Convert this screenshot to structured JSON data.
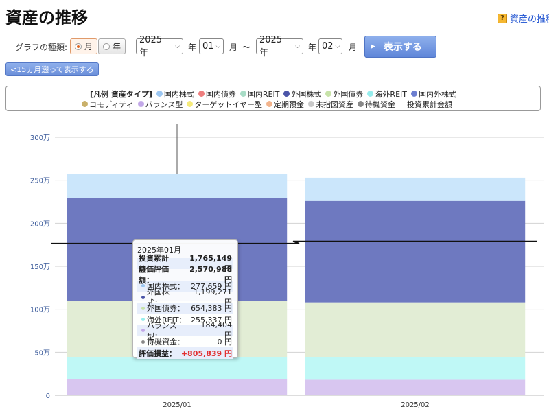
{
  "page": {
    "title": "資産の推移",
    "help_link": "資産の推移",
    "help_icon": "?"
  },
  "controls": {
    "graph_type_label": "グラフの種類:",
    "radio_month": "月",
    "radio_year": "年",
    "selected": "month",
    "from_year": "2025 年",
    "from_year_unit": "年",
    "from_month": "01",
    "from_month_unit": "月",
    "range_sep": "〜",
    "to_year": "2025 年",
    "to_year_unit": "年",
    "to_month": "02",
    "to_month_unit": "月",
    "show_button": "表示する",
    "back_button": "<15ヵ月遡って表示する"
  },
  "legend": {
    "heading": "[凡例 資産タイプ]",
    "items": [
      {
        "label": "国内株式",
        "color": "#9cc7f2"
      },
      {
        "label": "国内債券",
        "color": "#ee7e7e"
      },
      {
        "label": "国内REIT",
        "color": "#a8dcc6"
      },
      {
        "label": "外国株式",
        "color": "#4b55a8"
      },
      {
        "label": "外国債券",
        "color": "#c7e2a8"
      },
      {
        "label": "海外REIT",
        "color": "#96eded"
      },
      {
        "label": "国内外株式",
        "color": "#6d7fd0"
      },
      {
        "label": "コモディティ",
        "color": "#c9b06a"
      },
      {
        "label": "バランス型",
        "color": "#c2a8e8"
      },
      {
        "label": "ターゲットイヤー型",
        "color": "#f5ea7a"
      },
      {
        "label": "定期預金",
        "color": "#f3b48c"
      },
      {
        "label": "未指図資産",
        "color": "#c9c9c9"
      },
      {
        "label": "待機資金",
        "color": "#888888"
      }
    ],
    "line_label": "投資累計金額"
  },
  "chart_data": {
    "type": "bar",
    "stacked": true,
    "categories": [
      "2025/01",
      "2025/02"
    ],
    "ylim": [
      0,
      3000000
    ],
    "y_ticks": [
      {
        "value": 0,
        "label": "0"
      },
      {
        "value": 500000,
        "label": "50万"
      },
      {
        "value": 1000000,
        "label": "100万"
      },
      {
        "value": 1500000,
        "label": "150万"
      },
      {
        "value": 2000000,
        "label": "200万"
      },
      {
        "value": 2500000,
        "label": "250万"
      },
      {
        "value": 3000000,
        "label": "300万"
      }
    ],
    "series": [
      {
        "name": "バランス型",
        "color": "#d8c6f0",
        "values": [
          184404,
          180000
        ]
      },
      {
        "name": "海外REIT",
        "color": "#bff8f6",
        "values": [
          255337,
          260000
        ]
      },
      {
        "name": "外国債券",
        "color": "#e2edd5",
        "values": [
          654383,
          640000
        ]
      },
      {
        "name": "外国株式",
        "color": "#6e79c0",
        "values": [
          1199271,
          1180000
        ]
      },
      {
        "name": "国内株式",
        "color": "#cbe6fb",
        "values": [
          277659,
          270000
        ]
      }
    ],
    "line": {
      "name": "投資累計金額",
      "color": "#111111",
      "values": [
        1765149,
        1790000
      ]
    },
    "grid": true
  },
  "tooltip": {
    "date": "2025年01月",
    "rows": [
      {
        "label": "投資累計額：",
        "value": "1,765,149 円",
        "bold": true,
        "shaded": true,
        "dot": ""
      },
      {
        "label": "時価評価額：",
        "value": "2,570,988 円",
        "bold": true,
        "shaded": false,
        "dot": ""
      },
      {
        "label": "国内株式：",
        "value": "277,659 円",
        "bold": false,
        "shaded": true,
        "dot": "#9cc7f2"
      },
      {
        "label": "外国株式：",
        "value": "1,199,271 円",
        "bold": false,
        "shaded": false,
        "dot": "#4b55a8"
      },
      {
        "label": "外国債券：",
        "value": "654,383 円",
        "bold": false,
        "shaded": true,
        "dot": "#c7e2a8"
      },
      {
        "label": "海外REIT：",
        "value": "255,337 円",
        "bold": false,
        "shaded": false,
        "dot": "#96eded"
      },
      {
        "label": "バランス型：",
        "value": "184,404 円",
        "bold": false,
        "shaded": true,
        "dot": "#c2a8e8"
      },
      {
        "label": "待機資金：",
        "value": "0 円",
        "bold": false,
        "shaded": false,
        "dot": "#888888"
      }
    ],
    "profit_label": "評価損益：",
    "profit_value": "+805,839 円"
  }
}
